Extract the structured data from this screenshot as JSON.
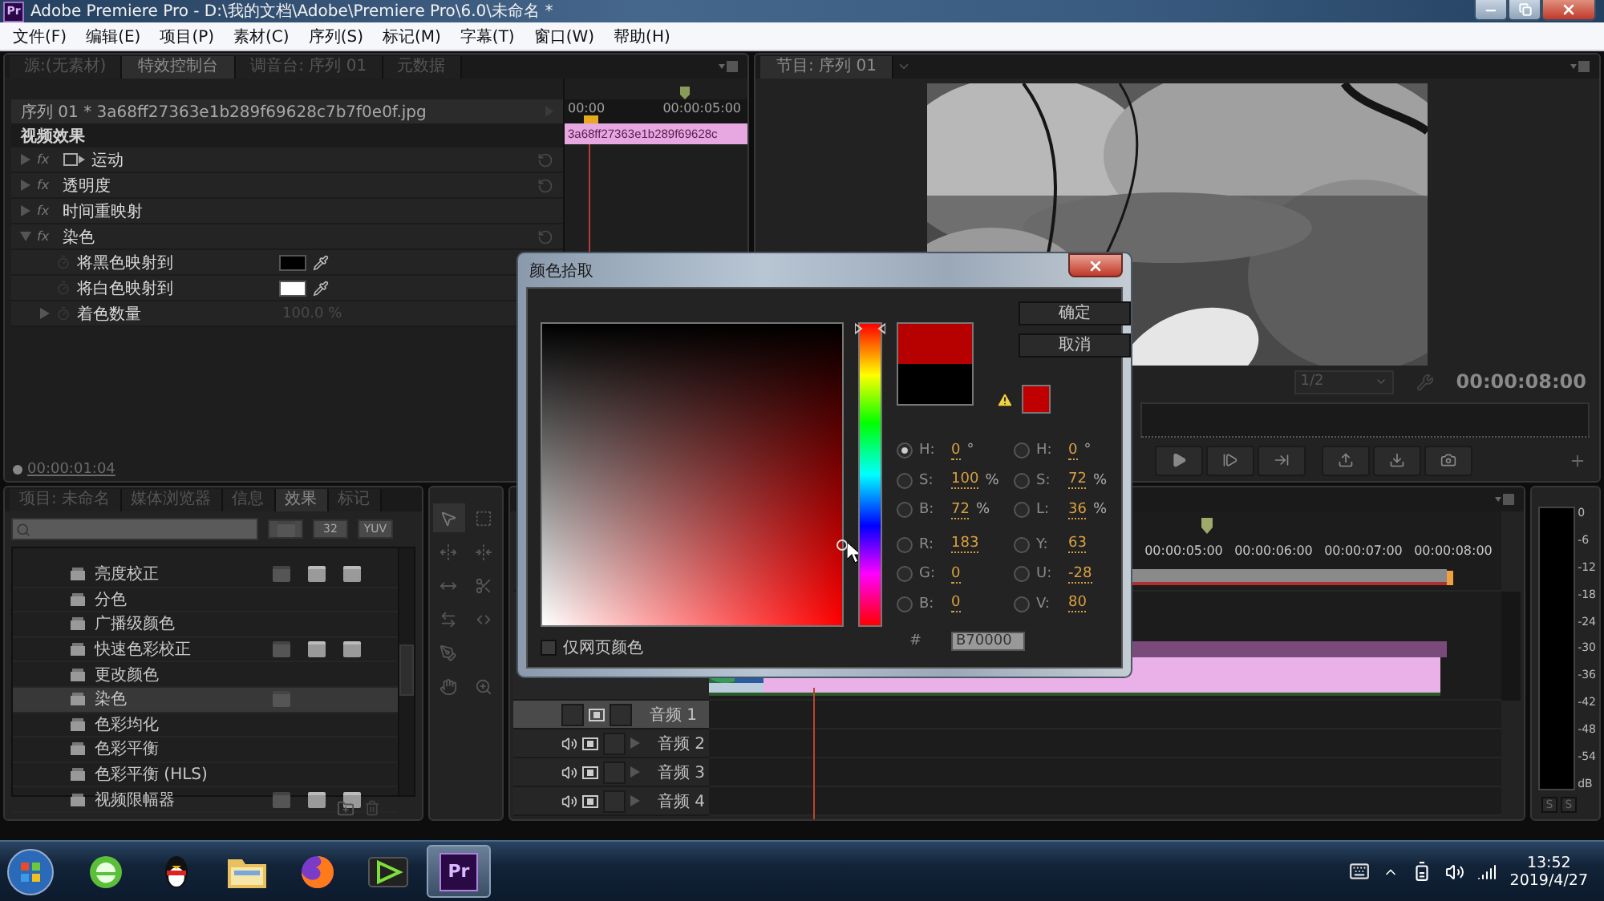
{
  "window": {
    "app_icon": "Pr",
    "title": "Adobe Premiere Pro - D:\\我的文档\\Adobe\\Premiere Pro\\6.0\\未命名 *"
  },
  "menu": [
    "文件(F)",
    "编辑(E)",
    "项目(P)",
    "素材(C)",
    "序列(S)",
    "标记(M)",
    "字幕(T)",
    "窗口(W)",
    "帮助(H)"
  ],
  "effect_controls": {
    "tabs": [
      {
        "label": "源:(无素材)",
        "selected": false
      },
      {
        "label": "特效控制台",
        "selected": true
      },
      {
        "label": "调音台: 序列 01",
        "selected": false
      },
      {
        "label": "元数据",
        "selected": false
      }
    ],
    "clip_path": "序列 01 * 3a68ff27363e1b289f69628c7b7f0e0f.jpg",
    "ruler": [
      "00:00",
      "00:00:05:00"
    ],
    "clip_label": "3a68ff27363e1b289f69628c",
    "section": "视频效果",
    "effects": [
      {
        "name": "运动",
        "badge": "fx",
        "kind": "motion",
        "expanded": false,
        "reset": true
      },
      {
        "name": "透明度",
        "badge": "fx",
        "kind": "plain",
        "expanded": false,
        "reset": true
      },
      {
        "name": "时间重映射",
        "badge": "fx",
        "kind": "plain",
        "expanded": false,
        "reset": false
      },
      {
        "name": "染色",
        "badge": "fx",
        "kind": "plain",
        "expanded": true,
        "reset": true,
        "children": [
          {
            "name": "将黑色映射到",
            "kind": "color",
            "color": "#000000"
          },
          {
            "name": "将白色映射到",
            "kind": "color",
            "color": "#ffffff"
          },
          {
            "name": "着色数量",
            "kind": "value",
            "value": "100.0 %"
          }
        ]
      }
    ],
    "timecode": "00:00:01:04"
  },
  "program_monitor": {
    "tab": "节目: 序列 01",
    "zoom": "1/2",
    "timecode": "00:00:08:00"
  },
  "effects_panel": {
    "tabs": [
      {
        "label": "项目: 未命名",
        "selected": false
      },
      {
        "label": "媒体浏览器",
        "selected": false
      },
      {
        "label": "信息",
        "selected": false
      },
      {
        "label": "效果",
        "selected": true
      },
      {
        "label": "标记",
        "selected": false
      }
    ],
    "filters": [
      "32",
      "YUV"
    ],
    "items": [
      {
        "name": "亮度校正",
        "selected": false,
        "accelerated": true,
        "bit32": true,
        "yuv": true
      },
      {
        "name": "分色",
        "selected": false,
        "accelerated": false,
        "bit32": false,
        "yuv": false
      },
      {
        "name": "广播级颜色",
        "selected": false,
        "accelerated": false,
        "bit32": false,
        "yuv": false
      },
      {
        "name": "快速色彩校正",
        "selected": false,
        "accelerated": true,
        "bit32": true,
        "yuv": true
      },
      {
        "name": "更改颜色",
        "selected": false,
        "accelerated": false,
        "bit32": false,
        "yuv": false
      },
      {
        "name": "染色",
        "selected": true,
        "accelerated": true,
        "bit32": false,
        "yuv": false
      },
      {
        "name": "色彩均化",
        "selected": false,
        "accelerated": false,
        "bit32": false,
        "yuv": false
      },
      {
        "name": "色彩平衡",
        "selected": false,
        "accelerated": false,
        "bit32": false,
        "yuv": false
      },
      {
        "name": "色彩平衡 (HLS)",
        "selected": false,
        "accelerated": false,
        "bit32": false,
        "yuv": false
      },
      {
        "name": "视频限幅器",
        "selected": false,
        "accelerated": true,
        "bit32": true,
        "yuv": true
      }
    ]
  },
  "timeline": {
    "ruler": [
      "00:00:05:00",
      "00:00:06:00",
      "00:00:07:00",
      "00:00:08:00"
    ],
    "audio_tracks": [
      {
        "name": "音频 1",
        "selected": true,
        "audible": false
      },
      {
        "name": "音频 2",
        "selected": false,
        "audible": true
      },
      {
        "name": "音频 3",
        "selected": false,
        "audible": true
      },
      {
        "name": "音频 4",
        "selected": false,
        "audible": true
      }
    ]
  },
  "audio_meter": {
    "scale": [
      "0",
      "-6",
      "-12",
      "-18",
      "-24",
      "-30",
      "-36",
      "-42",
      "-48",
      "-54",
      "dB"
    ],
    "solo": [
      "S",
      "S"
    ]
  },
  "color_picker": {
    "title": "颜色拾取",
    "ok": "确定",
    "cancel": "取消",
    "hue": {
      "level": 0
    },
    "fields_left": [
      {
        "label": "H:",
        "value": "0",
        "unit": "°",
        "selected": true
      },
      {
        "label": "S:",
        "value": "100",
        "unit": "%",
        "selected": false
      },
      {
        "label": "B:",
        "value": "72",
        "unit": "%",
        "selected": false
      },
      {
        "label": "R:",
        "value": "183",
        "selected": false
      },
      {
        "label": "G:",
        "value": "0",
        "selected": false
      },
      {
        "label": "B:",
        "value": "0",
        "selected": false
      }
    ],
    "fields_right": [
      {
        "label": "H:",
        "value": "0",
        "unit": "°",
        "selected": false
      },
      {
        "label": "S:",
        "value": "72",
        "unit": "%",
        "selected": false
      },
      {
        "label": "L:",
        "value": "36",
        "unit": "%",
        "selected": false
      },
      {
        "label": "Y:",
        "value": "63",
        "selected": false
      },
      {
        "label": "U:",
        "value": "-28",
        "selected": false
      },
      {
        "label": "V:",
        "value": "80",
        "selected": false
      }
    ],
    "hex_label": "#",
    "hex": "B70000",
    "web_only": {
      "label": "仅网页颜色",
      "checked": false
    }
  },
  "taskbar": {
    "apps": [
      {
        "kind": "browser",
        "selected": false
      },
      {
        "kind": "qq",
        "selected": false
      },
      {
        "kind": "folder",
        "selected": false
      },
      {
        "kind": "firefox",
        "selected": false
      },
      {
        "kind": "video",
        "selected": false
      },
      {
        "kind": "premiere",
        "label": "Pr",
        "selected": true
      }
    ],
    "time": "13:52",
    "date": "2019/4/27"
  }
}
